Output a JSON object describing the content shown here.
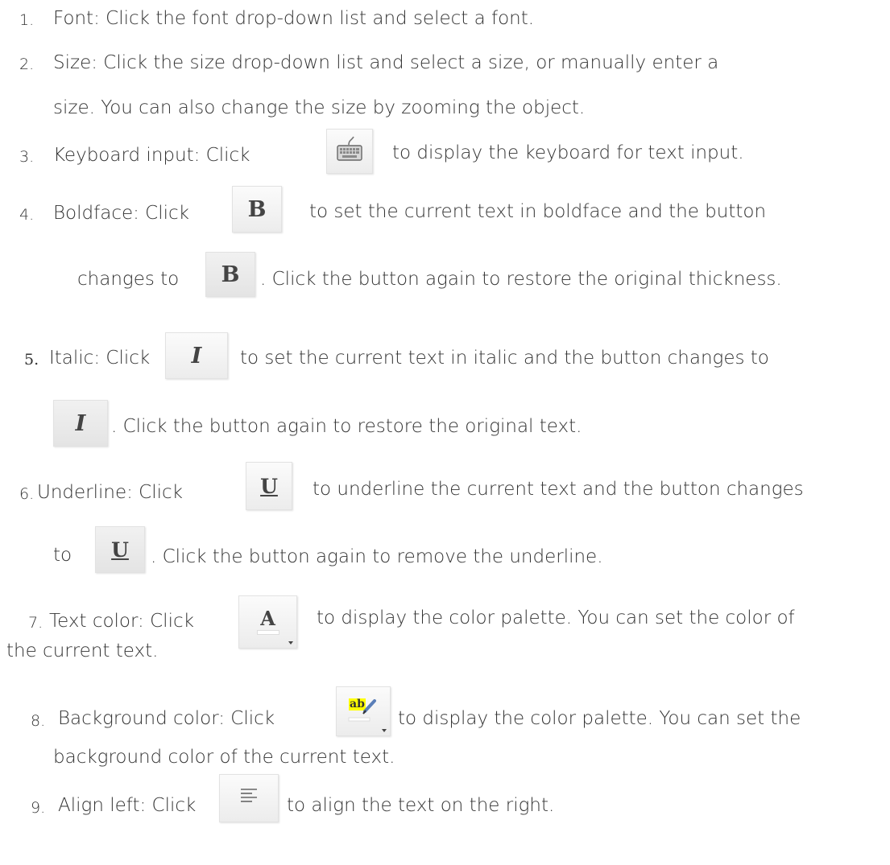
{
  "items": [
    {
      "num": "1.",
      "parts": [
        "Font: Click the font drop-down list and select a font."
      ]
    },
    {
      "num": "2.",
      "parts": [
        "Size: Click the size drop-down list and select a size, or manually enter a",
        "size. You can also change the size by zooming the object."
      ]
    },
    {
      "num": "3.",
      "parts": [
        "Keyboard input: Click",
        "to display the keyboard for text input."
      ]
    },
    {
      "num": "4.",
      "parts": [
        "Boldface:  Click",
        "to set the current text in boldface and the button",
        "changes to",
        ". Click the button again to restore the original thickness."
      ]
    },
    {
      "num": "5.",
      "parts": [
        "Italic: Click",
        "to set the current text in italic and the button changes to",
        ". Click the button again to restore the original text."
      ]
    },
    {
      "num": "6.",
      "parts": [
        "Underline: Click",
        "to underline the current text and the button changes",
        "to",
        ". Click the button again to remove the underline."
      ]
    },
    {
      "num": "7.",
      "parts": [
        "Text color: Click",
        "to display the color palette. You can set the color of",
        "the current text."
      ]
    },
    {
      "num": "8.",
      "parts": [
        "Background color: Click",
        "to display the color palette. You can set the",
        "background color of the current text."
      ]
    },
    {
      "num": "9.",
      "parts": [
        "Align left: Click",
        "to align the text on the right."
      ]
    }
  ],
  "buttons": {
    "bold": "B",
    "italic": "I",
    "underline": "U",
    "text_color": "A",
    "highlight_label": "ab"
  },
  "icons": {
    "keyboard": "keyboard-icon",
    "bold": "bold-icon",
    "italic": "italic-icon",
    "underline": "underline-icon",
    "text_color": "text-color-icon",
    "background_color": "highlight-pen-icon",
    "align_left": "align-left-icon"
  },
  "colors": {
    "text": "#333333",
    "highlight": "#ffff00"
  }
}
